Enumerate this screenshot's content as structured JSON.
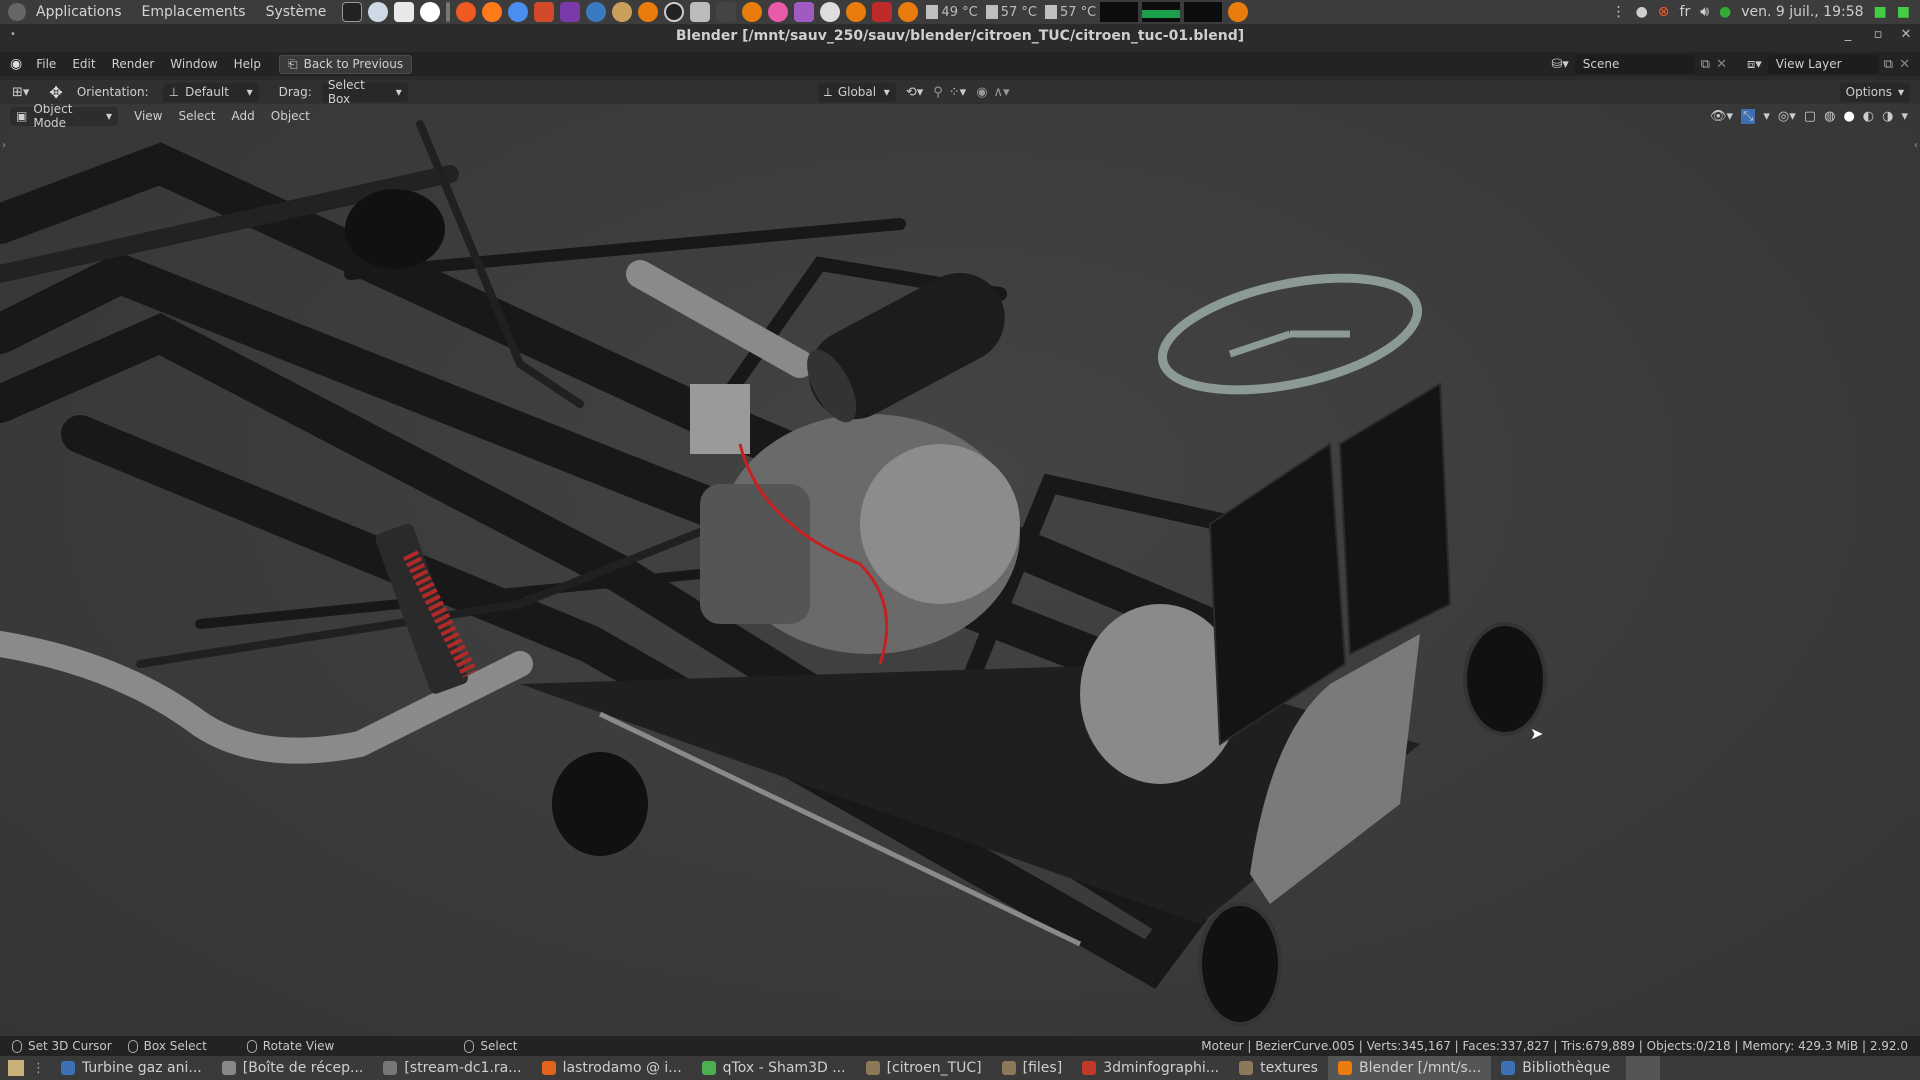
{
  "top_panel": {
    "menus": [
      "Applications",
      "Emplacements",
      "Système"
    ],
    "temperatures": [
      "49 °C",
      "57 °C",
      "57 °C"
    ],
    "keyboard_layout": "fr",
    "clock": "ven. 9 juil., 19:58"
  },
  "window": {
    "title": "Blender [/mnt/sauv_250/sauv/blender/citroen_TUC/citroen_tuc-01.blend]"
  },
  "menu_bar": {
    "items": [
      "File",
      "Edit",
      "Render",
      "Window",
      "Help"
    ],
    "back_button": "Back to Previous",
    "scene": "Scene",
    "view_layer": "View Layer"
  },
  "tool_header": {
    "orientation_label": "Orientation:",
    "orientation_value": "Default",
    "drag_label": "Drag:",
    "drag_value": "Select Box",
    "transform_orientation": "Global",
    "options": "Options"
  },
  "view_header": {
    "mode": "Object Mode",
    "menus": [
      "View",
      "Select",
      "Add",
      "Object"
    ]
  },
  "status_bar": {
    "hints": [
      "Set 3D Cursor",
      "Box Select",
      "Rotate View",
      "Select"
    ],
    "stats": "Moteur | BezierCurve.005 | Verts:345,167 | Faces:337,827 | Tris:679,889 | Objects:0/218 | Memory: 429.3 MiB | 2.92.0"
  },
  "taskbar": {
    "tasks": [
      {
        "label": "Turbine gaz ani...",
        "color": "#3d6fb5"
      },
      {
        "label": "[Boîte de récep...",
        "color": "#888888"
      },
      {
        "label": "[stream-dc1.ra...",
        "color": "#777777"
      },
      {
        "label": "lastrodamo @ i...",
        "color": "#e0651b"
      },
      {
        "label": "qTox - Sham3D ...",
        "color": "#4caf50"
      },
      {
        "label": "[citroen_TUC]",
        "color": "#8a7a5a"
      },
      {
        "label": "[files]",
        "color": "#8a7a5a"
      },
      {
        "label": "3dminfographi...",
        "color": "#c0392b"
      },
      {
        "label": "textures",
        "color": "#8a7a5a"
      },
      {
        "label": "Blender [/mnt/s...",
        "color": "#e87d0d"
      },
      {
        "label": "Bibliothèque",
        "color": "#3d6fb5"
      }
    ]
  },
  "colors": {
    "accent": "#e87d0d",
    "panel": "#3c3c3c",
    "viewport": "#3a3a3a"
  }
}
